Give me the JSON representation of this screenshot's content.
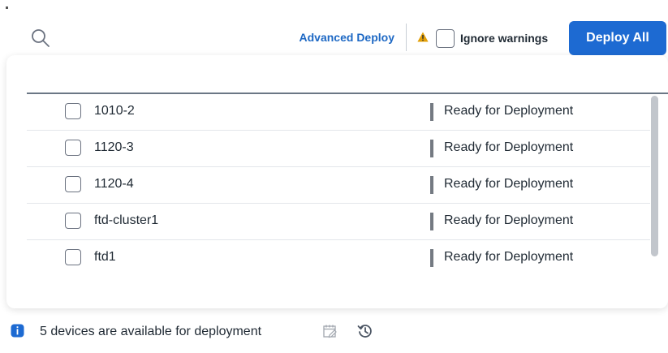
{
  "toolbar": {
    "search_icon": "search-icon",
    "advanced_deploy_label": "Advanced Deploy",
    "warning_icon": "warning-icon",
    "ignore_warnings_label": "Ignore warnings",
    "deploy_all_label": "Deploy All"
  },
  "devices": [
    {
      "name": "1010-2",
      "status": "Ready for Deployment"
    },
    {
      "name": "1120-3",
      "status": "Ready for Deployment"
    },
    {
      "name": "1120-4",
      "status": "Ready for Deployment"
    },
    {
      "name": "ftd-cluster1",
      "status": "Ready for Deployment"
    },
    {
      "name": "ftd1",
      "status": "Ready for Deployment"
    }
  ],
  "footer": {
    "info_icon": "info-icon",
    "message": "5 devices are available for deployment",
    "notes_icon": "notes-icon",
    "history_icon": "history-icon"
  },
  "colors": {
    "accent": "#1d6ad2",
    "link": "#1d68c4",
    "warning": "#e3a008",
    "status_bar": "#747a82"
  }
}
